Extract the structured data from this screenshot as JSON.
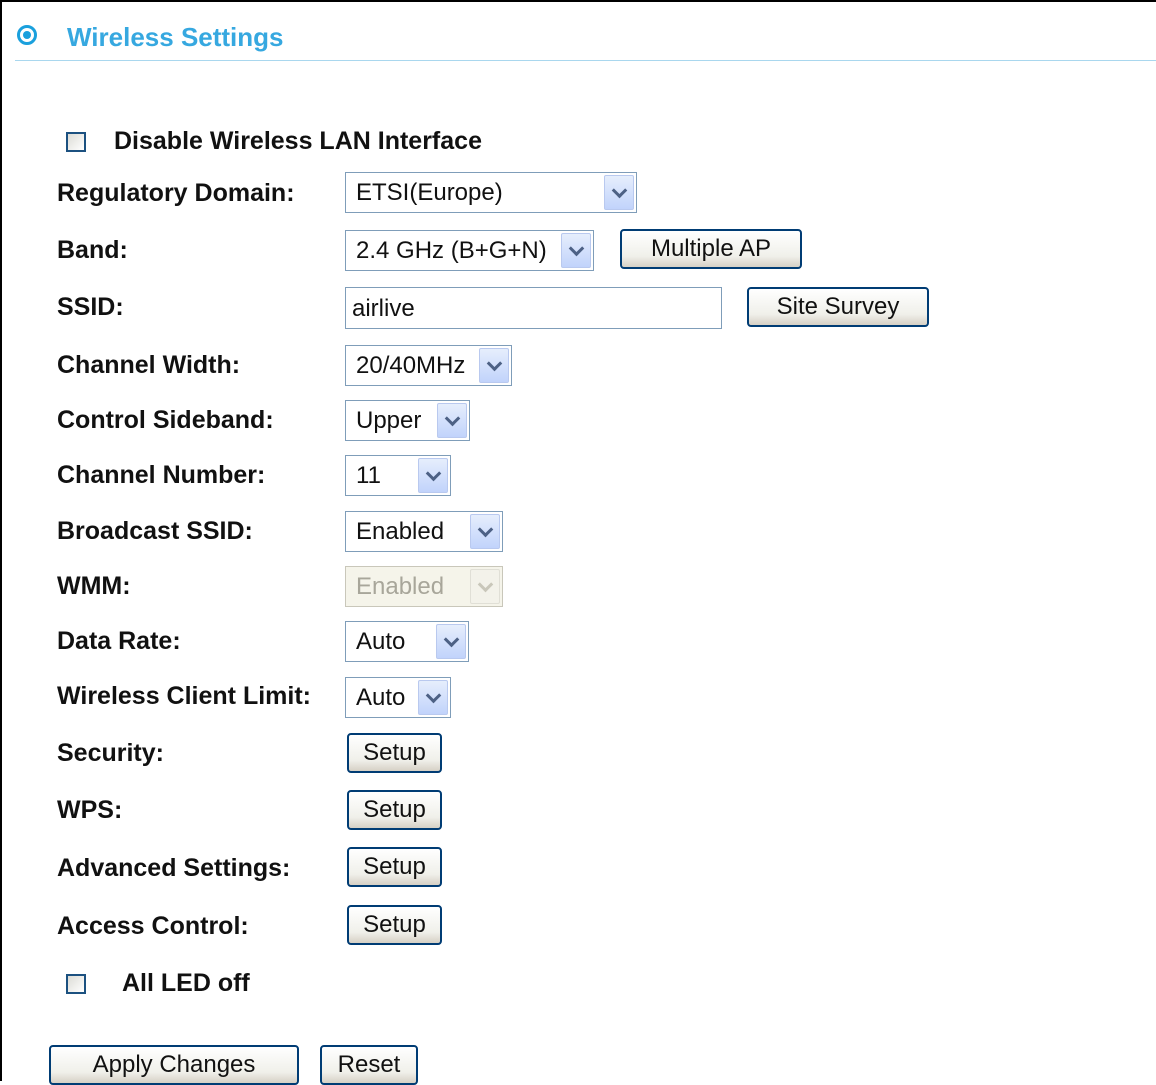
{
  "header": {
    "title": "Wireless Settings",
    "icon": "target-icon"
  },
  "disable_wlan": {
    "label": "Disable Wireless LAN Interface",
    "checked": false
  },
  "fields": {
    "regulatory_domain": {
      "label": "Regulatory Domain:",
      "value": "ETSI(Europe)"
    },
    "band": {
      "label": "Band:",
      "value": "2.4 GHz (B+G+N)"
    },
    "ssid": {
      "label": "SSID:",
      "value": "airlive"
    },
    "channel_width": {
      "label": "Channel Width:",
      "value": "20/40MHz"
    },
    "control_sideband": {
      "label": "Control Sideband:",
      "value": "Upper"
    },
    "channel_number": {
      "label": "Channel Number:",
      "value": "11"
    },
    "broadcast_ssid": {
      "label": "Broadcast SSID:",
      "value": "Enabled"
    },
    "wmm": {
      "label": "WMM:",
      "value": "Enabled",
      "disabled": true
    },
    "data_rate": {
      "label": "Data Rate:",
      "value": "Auto"
    },
    "client_limit": {
      "label": "Wireless Client Limit:",
      "value": "Auto"
    },
    "security": {
      "label": "Security:"
    },
    "wps": {
      "label": "WPS:"
    },
    "advanced": {
      "label": "Advanced Settings:"
    },
    "access_control": {
      "label": "Access Control:"
    }
  },
  "buttons": {
    "multiple_ap": "Multiple AP",
    "site_survey": "Site Survey",
    "setup": "Setup",
    "apply": "Apply Changes",
    "reset": "Reset"
  },
  "all_led_off": {
    "label": "All LED off",
    "checked": false
  },
  "colors": {
    "accent": "#36a8e0",
    "button_border": "#003c74",
    "input_border": "#7f9db9"
  }
}
